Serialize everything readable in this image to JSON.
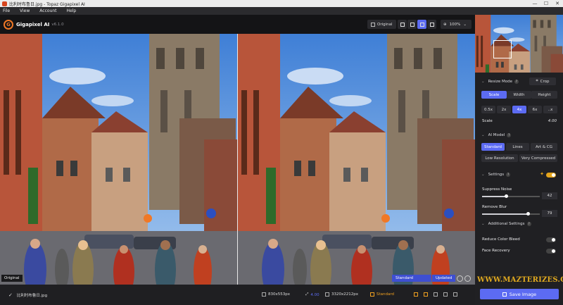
{
  "window": {
    "title": "比利时布鲁日.jpg - Topaz Gigapixel AI",
    "minimize": "—",
    "maximize": "☐",
    "close": "✕"
  },
  "menu": [
    "File",
    "View",
    "Account",
    "Help"
  ],
  "toolbar": {
    "brand_letter": "G",
    "app_name": "Gigapixel AI",
    "version": "v6.1.0",
    "original_label": "Original",
    "zoom": "100%",
    "zoom_caret": "⌄"
  },
  "preview": {
    "original_label": "Original",
    "standard_label": "Standard",
    "updated_label": "Updated"
  },
  "status": {
    "check": "✓",
    "filename": "比利时布鲁日.jpg",
    "input_size": "830x553px",
    "scale": "4.00",
    "output_size": "3320x2212px",
    "model": "Standard"
  },
  "sidebar": {
    "resize": {
      "title": "Resize Mode",
      "crop_label": "Crop",
      "modes": [
        "Scale",
        "Width",
        "Height"
      ],
      "active_mode": "Scale",
      "scales": [
        "0.5x",
        "2x",
        "4x",
        "6x",
        "..x"
      ],
      "active_scale": "4x",
      "scale_label": "Scale",
      "scale_value": "4.00"
    },
    "ai_model": {
      "title": "AI Model",
      "row1": [
        "Standard",
        "Lines",
        "Art & CG"
      ],
      "row2": [
        "Low Resolution",
        "Very Compressed"
      ],
      "active": "Standard"
    },
    "settings": {
      "title": "Settings",
      "auto_on": true,
      "suppress_noise_label": "Suppress Noise",
      "suppress_noise_value": "42",
      "suppress_noise_level": 0.42,
      "remove_blur_label": "Remove Blur",
      "remove_blur_value": "79",
      "remove_blur_level": 0.79
    },
    "additional": {
      "title": "Additional Settings",
      "reduce_color_bleed_label": "Reduce Color Bleed",
      "reduce_color_bleed_on": false,
      "face_recovery_label": "Face Recovery",
      "face_recovery_on": false
    },
    "watermark": "WWW.MAZTERIZES.COM",
    "save_label": "Save Image"
  },
  "colors": {
    "accent": "#5c6bf2",
    "orange": "#f07826",
    "toggle_on": "#e5a51c"
  }
}
